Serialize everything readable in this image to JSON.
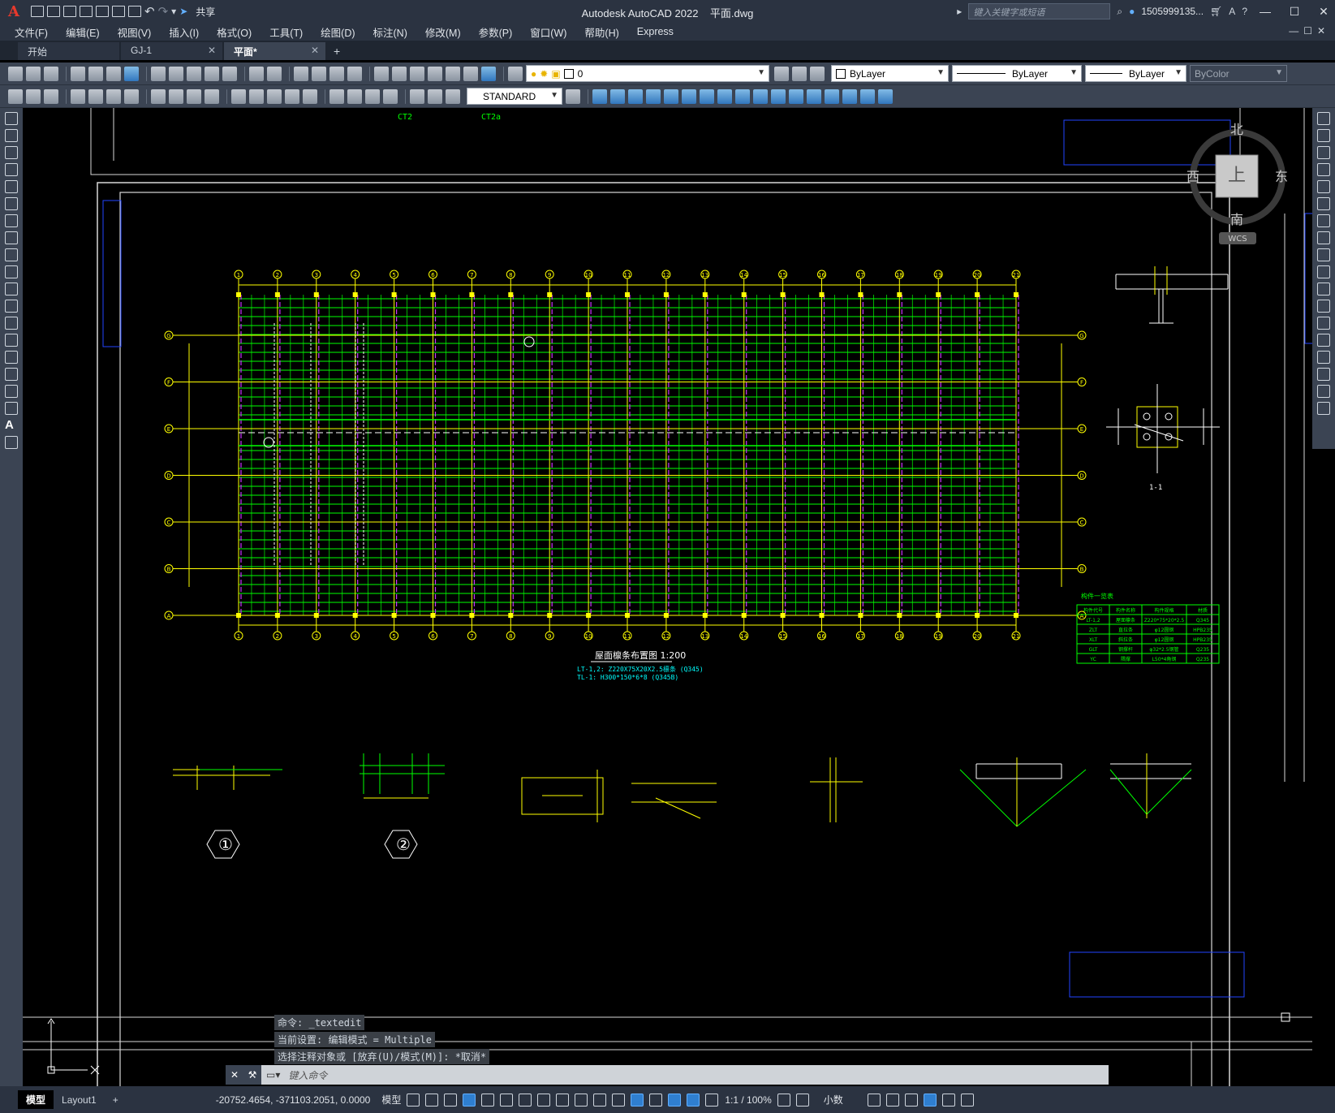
{
  "app": {
    "title": "Autodesk AutoCAD 2022",
    "filename": "平面.dwg",
    "share_label": "共享",
    "search_placeholder": "键入关键字或短语",
    "user": "1505999135...",
    "accent": "#e8392c"
  },
  "menu": [
    "文件(F)",
    "编辑(E)",
    "视图(V)",
    "插入(I)",
    "格式(O)",
    "工具(T)",
    "绘图(D)",
    "标注(N)",
    "修改(M)",
    "参数(P)",
    "窗口(W)",
    "帮助(H)",
    "Express"
  ],
  "tabs": [
    {
      "label": "开始"
    },
    {
      "label": "GJ-1"
    },
    {
      "label": "平面*"
    }
  ],
  "toolbar": {
    "layer_value": "0",
    "color_value": "ByLayer",
    "linetype_value": "ByLayer",
    "lineweight_value": "ByLayer",
    "plotstyle_value": "ByColor",
    "textstyle_value": "STANDARD"
  },
  "viewcube": {
    "north": "北",
    "south": "南",
    "east": "东",
    "west": "西",
    "top": "上",
    "wcs": "WCS"
  },
  "drawing": {
    "plan_title": "屋面檩条布置图 1:200",
    "note1": "LT-1,2: Z220X75X20X2.5檩条 (Q345)",
    "note2": "TL-1: H300*150*6*8 (Q345B)",
    "tag1": "CT2",
    "tag2": "CT2a",
    "section_label": "1-1",
    "detail1": "①",
    "detail2": "②",
    "table_title": "构件一览表",
    "table_headers": [
      "构件代号",
      "构件名称",
      "构件规格",
      "材质"
    ],
    "table_rows": [
      [
        "LT-1,2",
        "屋面檩条",
        "Z220*75*20*2.5",
        "Q345"
      ],
      [
        "ZLT",
        "直拉条",
        "φ12圆钢",
        "HPB235"
      ],
      [
        "XLT",
        "斜拉条",
        "φ12圆钢",
        "HPB235"
      ],
      [
        "GLT",
        "钢撑杆",
        "φ32*2.5钢管",
        "Q235"
      ],
      [
        "YC",
        "隅撑",
        "L50*4角钢",
        "Q235"
      ]
    ],
    "grid_cols": [
      "1",
      "2",
      "3",
      "4",
      "5",
      "6",
      "7",
      "8",
      "9",
      "10",
      "11",
      "12",
      "13",
      "14",
      "15",
      "16",
      "17",
      "18",
      "19",
      "20",
      "21"
    ],
    "grid_rows": [
      "G",
      "F",
      "E",
      "D",
      "C",
      "B",
      "A"
    ]
  },
  "command": {
    "history": [
      "命令: _textedit",
      "当前设置: 编辑模式 = Multiple",
      "选择注释对象或 [放弃(U)/模式(M)]: *取消*"
    ],
    "placeholder": "键入命令"
  },
  "status": {
    "model_tab": "模型",
    "layout_tab": "Layout1",
    "coords": "-20752.4654, -371103.2051, 0.0000",
    "mode": "模型",
    "scale": "1:1 / 100%",
    "units": "小数"
  }
}
